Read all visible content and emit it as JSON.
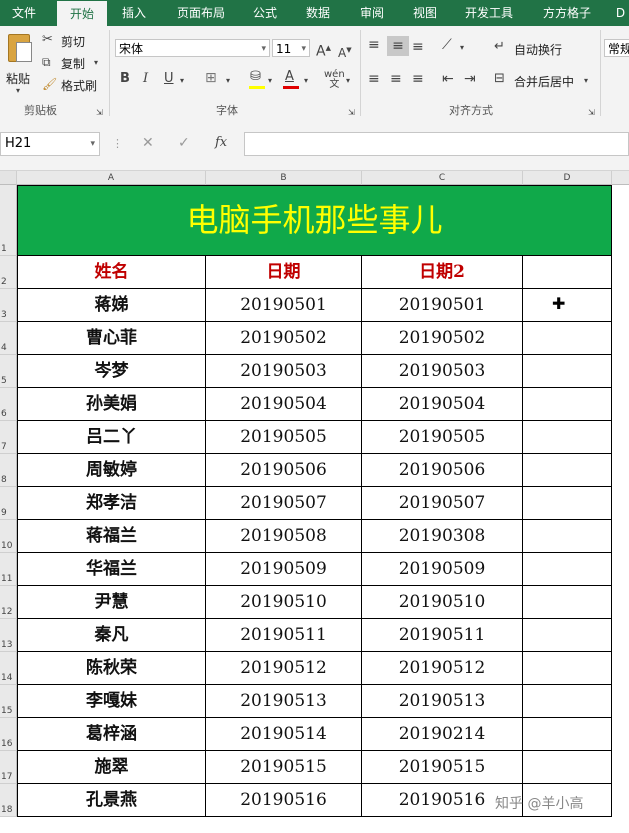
{
  "tabs": [
    "文件",
    "开始",
    "插入",
    "页面布局",
    "公式",
    "数据",
    "审阅",
    "视图",
    "开发工具",
    "方方格子",
    "D"
  ],
  "ribbon": {
    "paste_label": "粘贴",
    "cut_label": "剪切",
    "copy_label": "复制",
    "format_painter_label": "格式刷",
    "clipboard_group": "剪贴板",
    "font_name": "宋体",
    "font_size": "11",
    "font_group": "字体",
    "bold": "B",
    "italic": "I",
    "underline": "U",
    "wrap_text_label": "自动换行",
    "merge_center_label": "合并后居中",
    "align_group": "对齐方式",
    "number_format": "常规"
  },
  "formula_bar": {
    "name_box": "H21",
    "fx": "fx",
    "value": ""
  },
  "columns": [
    "A",
    "B",
    "C",
    "D"
  ],
  "rows": [
    "1",
    "2",
    "3",
    "4",
    "5",
    "6",
    "7",
    "8",
    "9",
    "10",
    "11",
    "12",
    "13",
    "14",
    "15",
    "16",
    "17",
    "18"
  ],
  "sheet": {
    "title": "电脑手机那些事儿",
    "headers": [
      "姓名",
      "日期",
      "日期2",
      ""
    ],
    "data": [
      [
        "蒋娣",
        "20190501",
        "20190501"
      ],
      [
        "曹心菲",
        "20190502",
        "20190502"
      ],
      [
        "岑梦",
        "20190503",
        "20190503"
      ],
      [
        "孙美娟",
        "20190504",
        "20190504"
      ],
      [
        "吕二丫",
        "20190505",
        "20190505"
      ],
      [
        "周敏婷",
        "20190506",
        "20190506"
      ],
      [
        "郑孝洁",
        "20190507",
        "20190507"
      ],
      [
        "蒋福兰",
        "20190508",
        "20190308"
      ],
      [
        "华福兰",
        "20190509",
        "20190509"
      ],
      [
        "尹慧",
        "20190510",
        "20190510"
      ],
      [
        "秦凡",
        "20190511",
        "20190511"
      ],
      [
        "陈秋荣",
        "20190512",
        "20190512"
      ],
      [
        "李嘎妹",
        "20190513",
        "20190513"
      ],
      [
        "葛梓涵",
        "20190514",
        "20190214"
      ],
      [
        "施翠",
        "20190515",
        "20190515"
      ],
      [
        "孔景燕",
        "20190516",
        "20190516"
      ]
    ]
  },
  "watermark": "知乎 @羊小高",
  "colors": {
    "excel_green": "#217346",
    "title_bg": "#10a94a",
    "title_text": "#ffff00",
    "header_text": "#c00000"
  }
}
